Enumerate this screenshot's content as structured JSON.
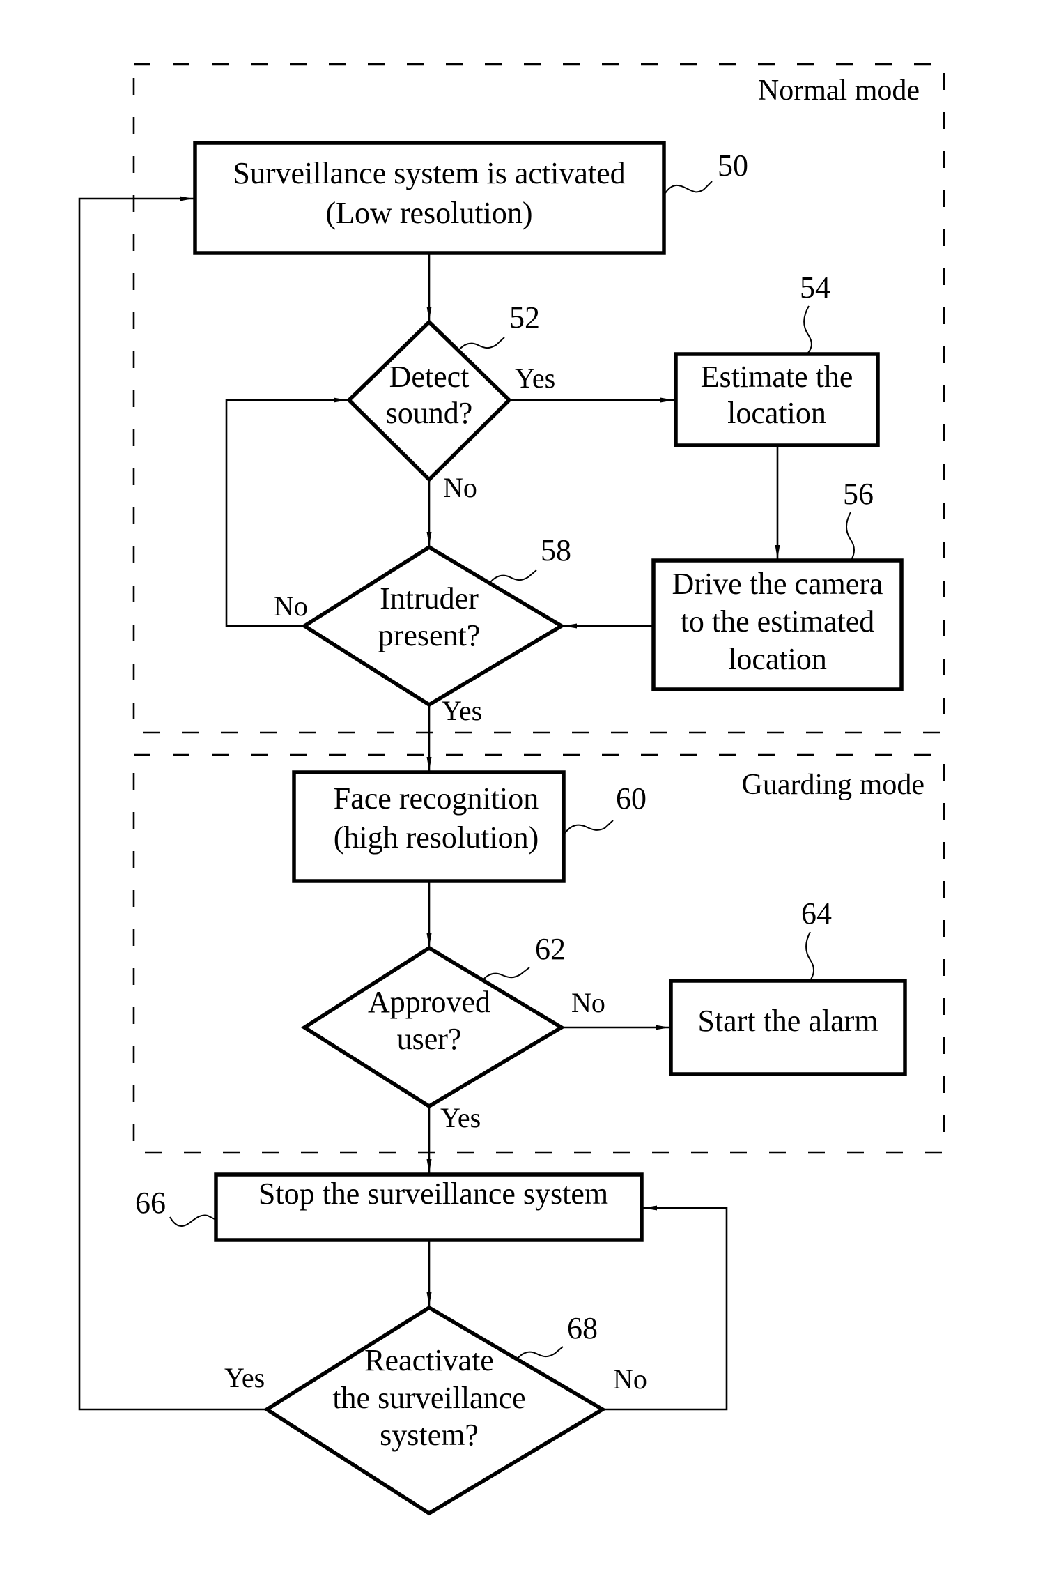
{
  "diagram": {
    "type": "flowchart",
    "regions": {
      "normal_mode": {
        "label": "Normal mode"
      },
      "guarding_mode": {
        "label": "Guarding mode"
      }
    },
    "nodes": {
      "n50": {
        "ref": "50",
        "kind": "process",
        "lines": [
          "Surveillance system is activated",
          "(Low resolution)"
        ]
      },
      "n52": {
        "ref": "52",
        "kind": "decision",
        "lines": [
          "Detect",
          "sound?"
        ]
      },
      "n54": {
        "ref": "54",
        "kind": "process",
        "lines": [
          "Estimate the",
          "location"
        ]
      },
      "n56": {
        "ref": "56",
        "kind": "process",
        "lines": [
          "Drive the camera",
          "to the estimated",
          "location"
        ]
      },
      "n58": {
        "ref": "58",
        "kind": "decision",
        "lines": [
          "Intruder",
          "present?"
        ]
      },
      "n60": {
        "ref": "60",
        "kind": "process",
        "lines": [
          "Face recognition",
          "(high resolution)"
        ]
      },
      "n62": {
        "ref": "62",
        "kind": "decision",
        "lines": [
          "Approved",
          "user?"
        ]
      },
      "n64": {
        "ref": "64",
        "kind": "process",
        "lines": [
          "Start the alarm"
        ]
      },
      "n66": {
        "ref": "66",
        "kind": "process",
        "lines": [
          "Stop the surveillance system"
        ]
      },
      "n68": {
        "ref": "68",
        "kind": "decision",
        "lines": [
          "Reactivate",
          "the surveillance",
          "system?"
        ]
      }
    },
    "edges": [
      {
        "from": "50",
        "to": "52",
        "label": ""
      },
      {
        "from": "52",
        "to": "54",
        "label": "Yes"
      },
      {
        "from": "52",
        "to": "58",
        "label": "No"
      },
      {
        "from": "54",
        "to": "56",
        "label": ""
      },
      {
        "from": "56",
        "to": "58",
        "label": ""
      },
      {
        "from": "58",
        "to": "52",
        "label": "No"
      },
      {
        "from": "58",
        "to": "60",
        "label": "Yes"
      },
      {
        "from": "60",
        "to": "62",
        "label": ""
      },
      {
        "from": "62",
        "to": "64",
        "label": "No"
      },
      {
        "from": "62",
        "to": "66",
        "label": "Yes"
      },
      {
        "from": "66",
        "to": "68",
        "label": ""
      },
      {
        "from": "68",
        "to": "50",
        "label": "Yes"
      },
      {
        "from": "68",
        "to": "66",
        "label": "No"
      }
    ]
  }
}
